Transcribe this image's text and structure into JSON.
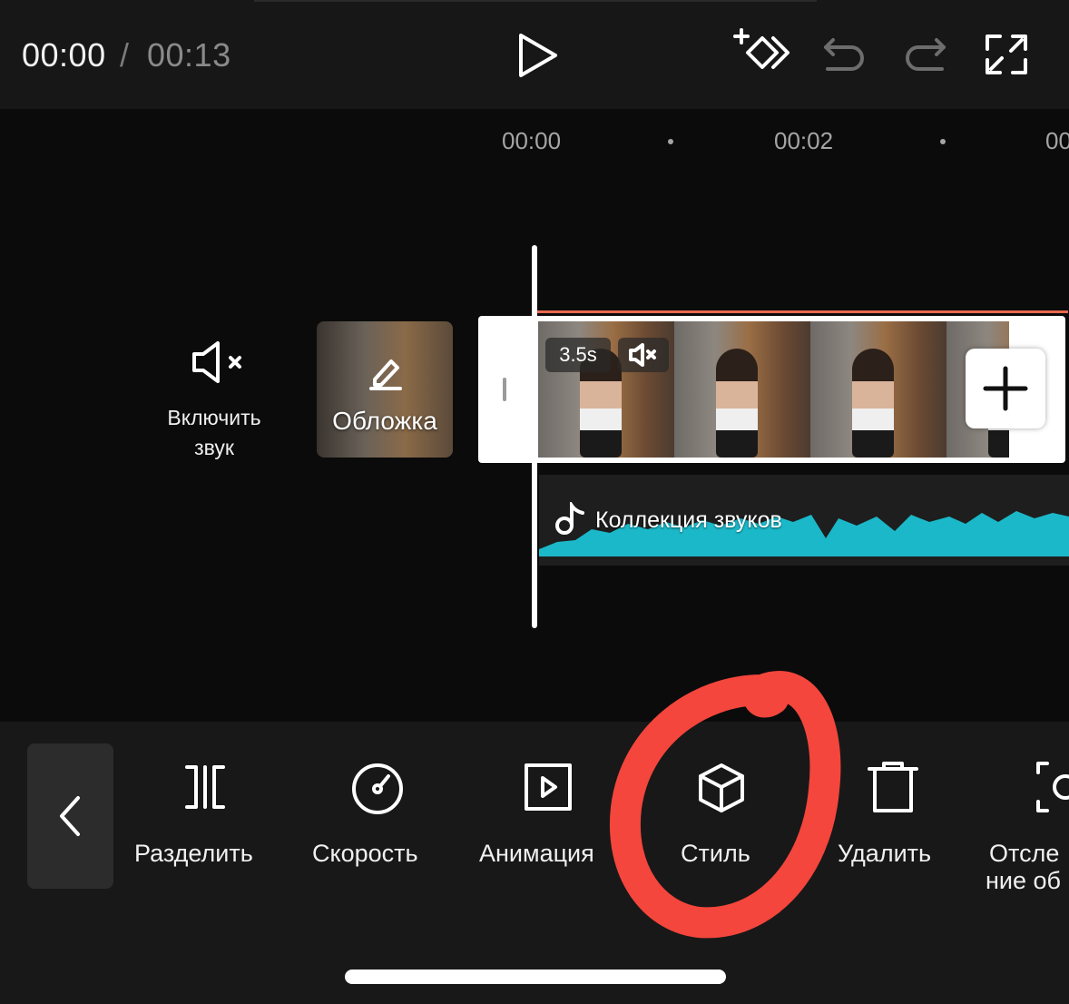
{
  "header": {
    "current_time": "00:00",
    "separator": "/",
    "total_time": "00:13",
    "icons": [
      "play-icon",
      "add-keyframe-icon",
      "undo-icon",
      "redo-icon",
      "fullscreen-icon"
    ]
  },
  "ruler": {
    "ticks": [
      "00:00",
      "00:02",
      "00"
    ]
  },
  "timeline": {
    "mute_toggle_label": "Включить звук",
    "cover_label": "Обложка",
    "clip_duration": "3.5s",
    "audio_label": "Коллекция звуков"
  },
  "toolbar": {
    "tools": [
      {
        "label": "Разделить",
        "icon": "split-icon"
      },
      {
        "label": "Скорость",
        "icon": "speed-icon"
      },
      {
        "label": "Анимация",
        "icon": "animation-icon"
      },
      {
        "label": "Стиль",
        "icon": "style-cube-icon"
      },
      {
        "label": "Удалить",
        "icon": "delete-icon"
      },
      {
        "label": "Отсле",
        "label2": "ние об",
        "icon": "tracking-icon"
      }
    ]
  },
  "colors": {
    "accent_audio": "#1bb8c9",
    "annotation": "#f4463c",
    "clip_trim_line": "#e8694e"
  }
}
